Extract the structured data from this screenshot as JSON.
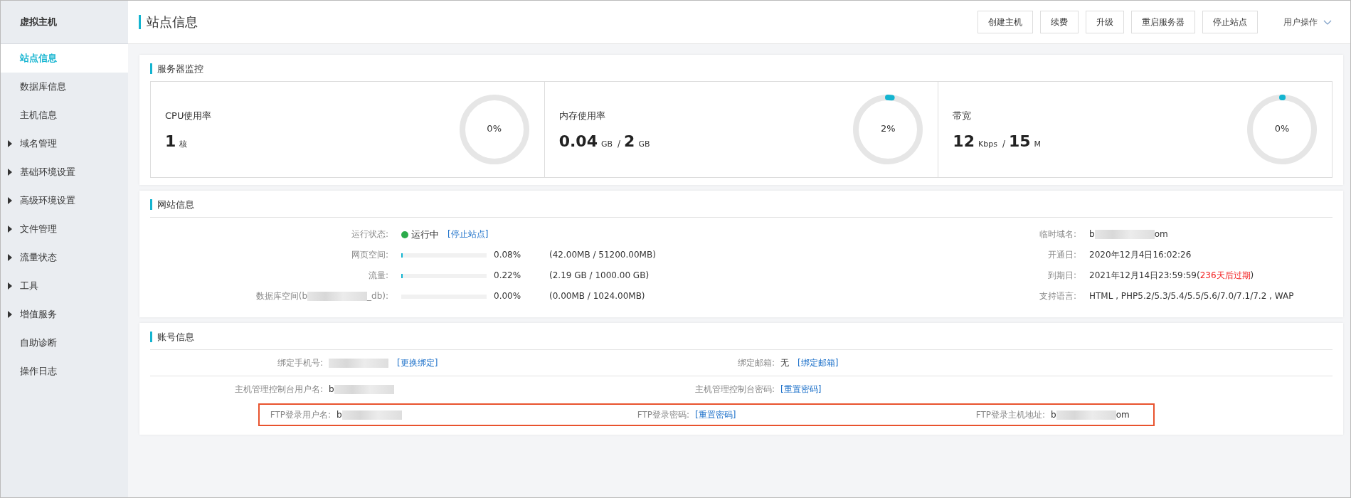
{
  "sidebar": {
    "title": "虚拟主机",
    "items": [
      {
        "label": "站点信息",
        "selected": true,
        "expandable": false
      },
      {
        "label": "数据库信息",
        "selected": false,
        "expandable": false
      },
      {
        "label": "主机信息",
        "selected": false,
        "expandable": false
      },
      {
        "label": "域名管理",
        "selected": false,
        "expandable": true
      },
      {
        "label": "基础环境设置",
        "selected": false,
        "expandable": true
      },
      {
        "label": "高级环境设置",
        "selected": false,
        "expandable": true
      },
      {
        "label": "文件管理",
        "selected": false,
        "expandable": true
      },
      {
        "label": "流量状态",
        "selected": false,
        "expandable": true
      },
      {
        "label": "工具",
        "selected": false,
        "expandable": true
      },
      {
        "label": "增值服务",
        "selected": false,
        "expandable": true
      },
      {
        "label": "自助诊断",
        "selected": false,
        "expandable": false
      },
      {
        "label": "操作日志",
        "selected": false,
        "expandable": false
      }
    ]
  },
  "header": {
    "title": "站点信息",
    "buttons": [
      "创建主机",
      "续费",
      "升级",
      "重启服务器",
      "停止站点"
    ],
    "user_menu": "用户操作"
  },
  "server_monitor": {
    "title": "服务器监控",
    "cards": [
      {
        "label": "CPU使用率",
        "values": [
          {
            "number": "1",
            "unit": "核"
          }
        ],
        "reading": "0%"
      },
      {
        "label": "内存使用率",
        "values": [
          {
            "number": "0.04",
            "unit": "GB"
          },
          {
            "separator": "/",
            "number": "2",
            "unit": "GB"
          }
        ],
        "level": 0.02,
        "reading": "2%"
      },
      {
        "label": "带宽",
        "values": [
          {
            "number": "12",
            "unit": "Kbps"
          },
          {
            "separator": "/",
            "number": "15",
            "unit": "M"
          }
        ],
        "level": 0.004,
        "reading": "0%"
      }
    ]
  },
  "website_info": {
    "title": "网站信息",
    "left": [
      {
        "kind": "status",
        "label_start": "运行状态:",
        "status": "运行中",
        "running": true,
        "link": "[停止站点]"
      },
      {
        "kind": "usage",
        "label_start": "网页空间:",
        "level": 0.0008,
        "percent": "0.08%",
        "detail": "(42.00MB / 51200.00MB)"
      },
      {
        "kind": "usage",
        "label_start": "流量:",
        "level": 0.0022,
        "percent": "0.22%",
        "detail": "(2.19 GB / 1000.00 GB)"
      },
      {
        "kind": "usage",
        "label_start": "数据库空间(b",
        "label_redacted": true,
        "label_end": "_db):",
        "level": 0,
        "percent": "0.00%",
        "detail": "(0.00MB / 1024.00MB)"
      }
    ],
    "right": [
      {
        "label": "临时域名:",
        "value_start": "b",
        "redacted": true,
        "value_end": "om"
      },
      {
        "label": "开通日:",
        "value_start": "2020年12月4日16:02:26"
      },
      {
        "label": "到期日:",
        "value_start": "2021年12月14日23:59:59(",
        "warning": "236天后过期",
        "value_end": ")"
      },
      {
        "label": "支持语言:",
        "value_start": "HTML , PHP5.2/5.3/5.4/5.5/5.6/7.0/7.1/7.2 , WAP"
      }
    ]
  },
  "account_info": {
    "title": "账号信息",
    "rows": [
      {
        "highlighted": false,
        "fields": [
          {
            "label": "绑定手机号:",
            "redacted": true,
            "link": "[更换绑定]"
          },
          {
            "label": "绑定邮箱:",
            "value_start": "无",
            "link": "[绑定邮箱]"
          }
        ]
      },
      {
        "highlighted": false,
        "fields": [
          {
            "label": "主机管理控制台用户名:",
            "value_start": "b",
            "redacted": true
          },
          {
            "label": "主机管理控制台密码:",
            "link": "[重置密码]"
          }
        ]
      },
      {
        "highlighted": true,
        "fields": [
          {
            "label": "FTP登录用户名:",
            "value_start": "b",
            "redacted": true
          },
          {
            "label": "FTP登录密码:",
            "link": "[重置密码]"
          },
          {
            "label": "FTP登录主机地址:",
            "value_start": "b",
            "redacted": true,
            "value_end": "om"
          }
        ]
      }
    ]
  }
}
